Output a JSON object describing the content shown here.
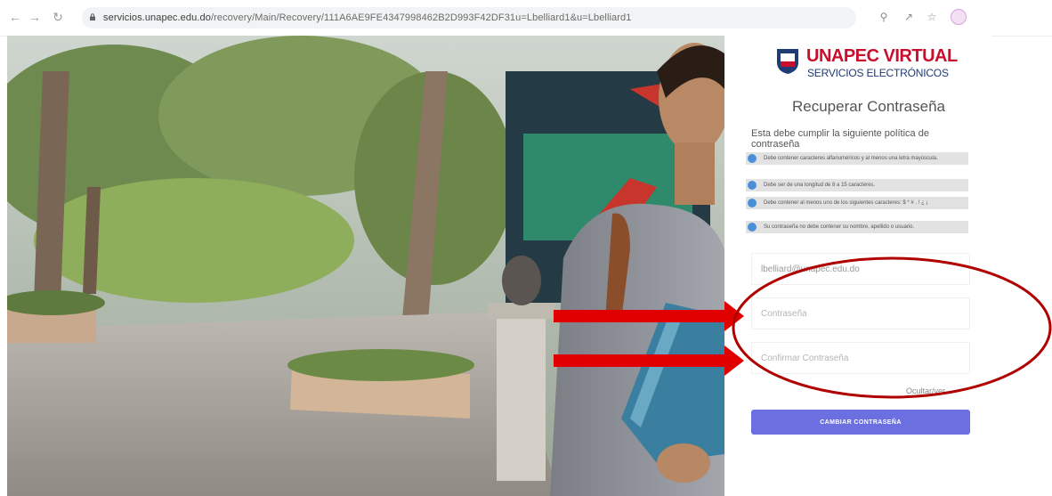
{
  "browser": {
    "url_host": "servicios.unapec.edu.do",
    "url_path": "/recovery/Main/Recovery/111A6AE9FE4347998462B2D993F42DF31u=Lbelliard1&u=Lbelliard1",
    "icons": [
      "back-icon",
      "forward-icon",
      "reload-icon",
      "lock-icon",
      "zoom-icon",
      "share-icon",
      "star-icon",
      "profile-avatar"
    ]
  },
  "brand": {
    "title": "UNAPEC VIRTUAL",
    "subtitle": "SERVICIOS ELECTRÓNICOS",
    "colors": {
      "red": "#c8102e",
      "navy": "#1f3a74"
    }
  },
  "form": {
    "title": "Recuperar Contraseña",
    "policy_intro": "Esta debe cumplir la siguiente política de contraseña",
    "rules": [
      "Debe contener caracteres alfanuméricos y al menos una letra mayúscula.",
      "Debe ser de una longitud de 8 a 15 caracteres.",
      "Debe contener al menos uno de los siguientes caracteres: $ * # . ! ¿ ¡",
      "Su contraseña no debe contener su nombre, apellido o usuario."
    ],
    "username_value": "lbelliard@unapec.edu.do",
    "password_placeholder": "Contraseña",
    "confirm_placeholder": "Confirmar Contraseña",
    "show_link": "Ocultar/ver",
    "submit_label": "CAMBIAR CONTRASEÑA",
    "accent_color": "#6c6fe0"
  },
  "annotations": {
    "color": "#e00000"
  }
}
